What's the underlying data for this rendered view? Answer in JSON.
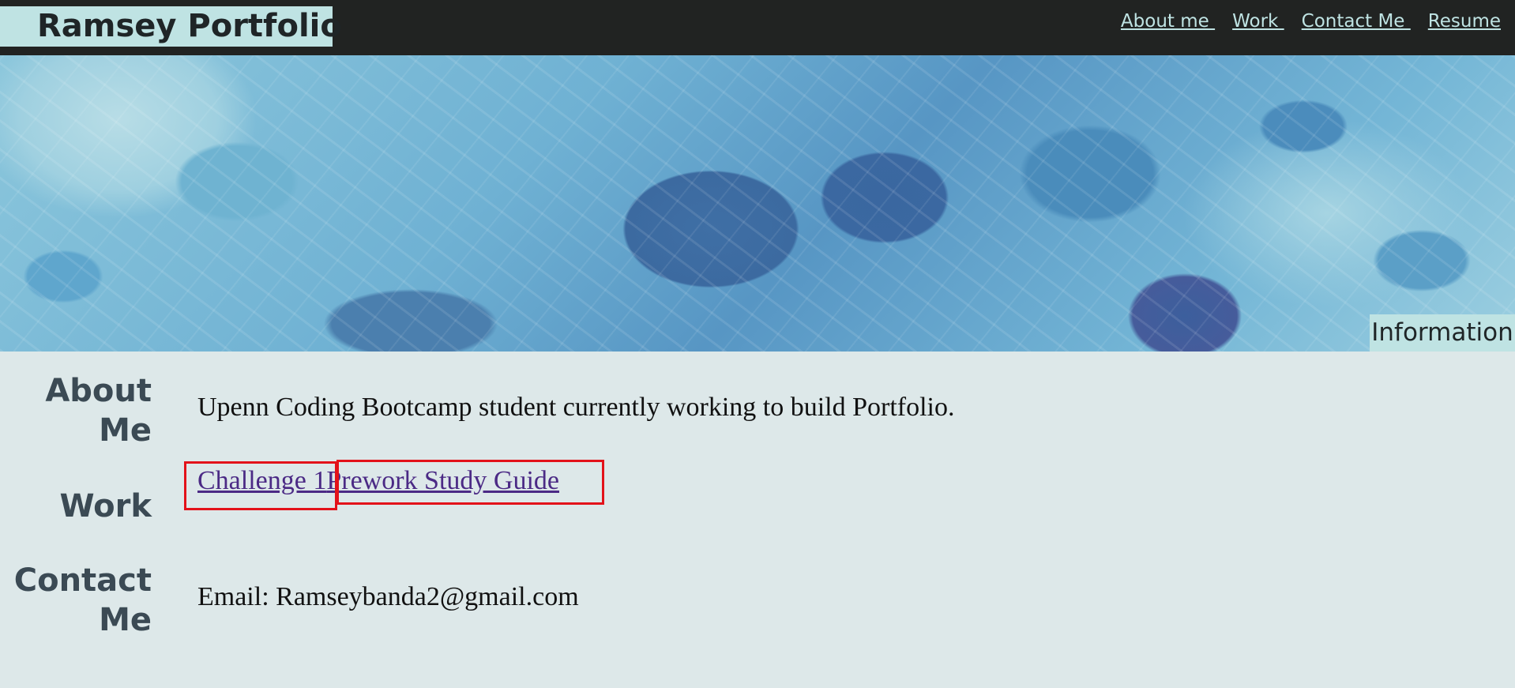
{
  "header": {
    "brand": "Ramsey Portfolio",
    "nav": [
      {
        "label": "About me "
      },
      {
        "label": "Work "
      },
      {
        "label": "Contact Me "
      },
      {
        "label": "Resume"
      }
    ]
  },
  "hero": {
    "badge": "Information"
  },
  "sections": {
    "about": {
      "heading": "About Me",
      "text": "Upenn Coding Bootcamp student currently working to build Portfolio."
    },
    "work": {
      "heading": "Work",
      "links": [
        {
          "label": "Challenge 1"
        },
        {
          "label": "Prework Study Guide"
        }
      ]
    },
    "contact": {
      "heading": "Contact Me",
      "text": "Email: Ramseybanda2@gmail.com"
    }
  },
  "colors": {
    "header_bg": "#212322",
    "brand_bg": "#bfe3e3",
    "page_bg": "#dde8e9",
    "heading": "#3b4a54",
    "link_visited": "#4b2a85",
    "highlight_box": "#e3121a"
  }
}
